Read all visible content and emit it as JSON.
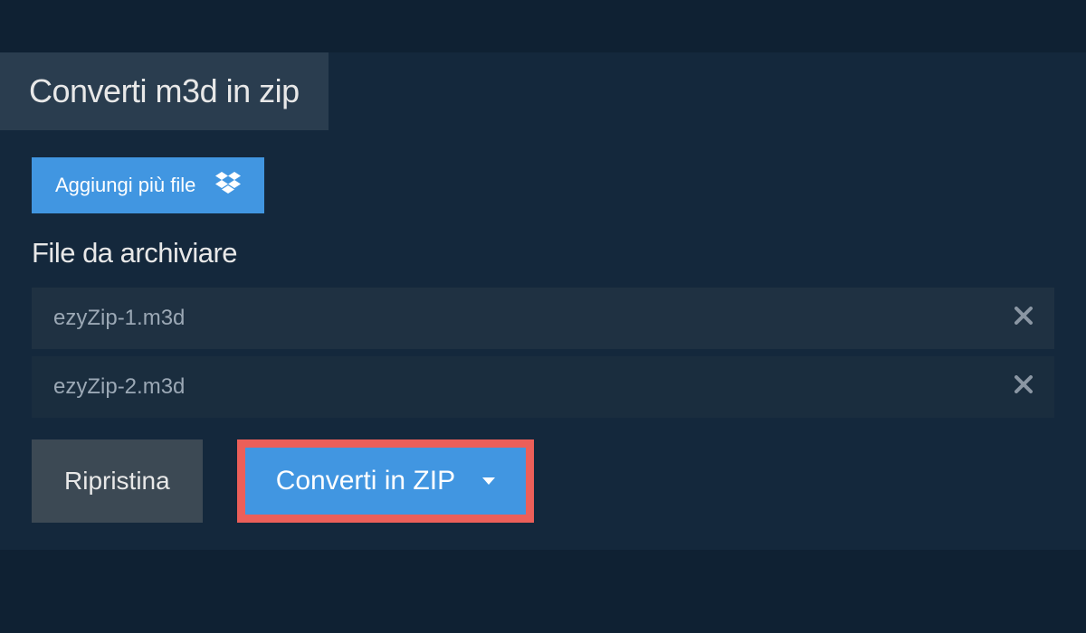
{
  "tab": {
    "title": "Converti m3d in zip"
  },
  "addFiles": {
    "label": "Aggiungi più file"
  },
  "section": {
    "title": "File da archiviare"
  },
  "files": [
    {
      "name": "ezyZip-1.m3d"
    },
    {
      "name": "ezyZip-2.m3d"
    }
  ],
  "actions": {
    "reset": "Ripristina",
    "convert": "Converti in ZIP"
  }
}
